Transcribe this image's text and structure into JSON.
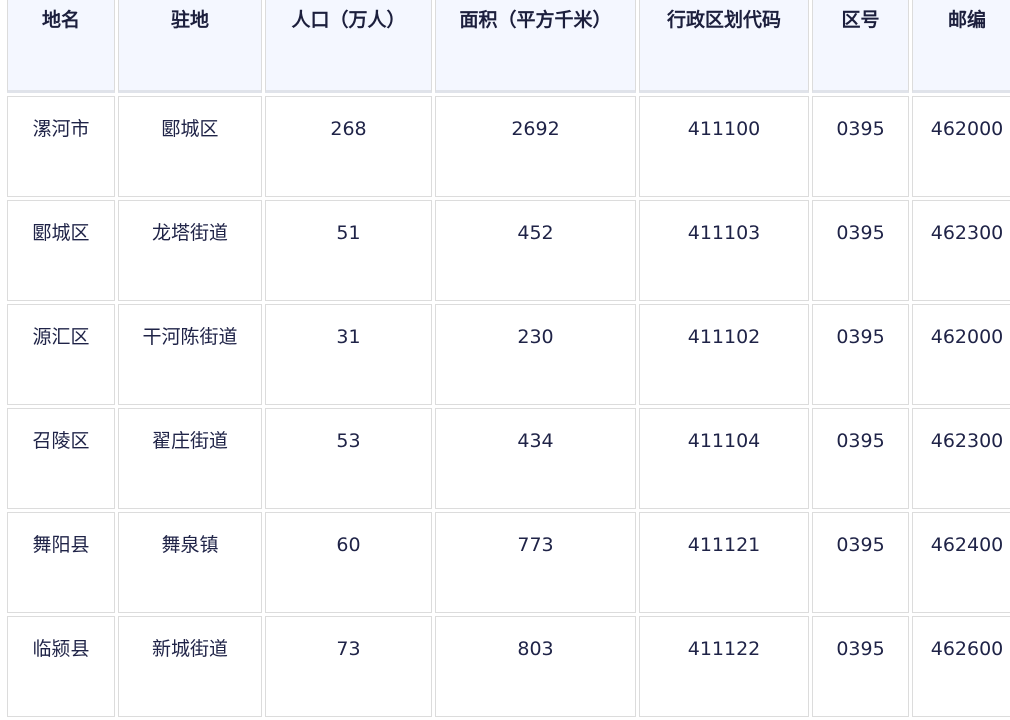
{
  "table": {
    "headers": [
      "地名",
      "驻地",
      "人口（万人）",
      "面积（平方千米）",
      "行政区划代码",
      "区号",
      "邮编"
    ],
    "rows": [
      [
        "漯河市",
        "郾城区",
        "268",
        "2692",
        "411100",
        "0395",
        "462000"
      ],
      [
        "郾城区",
        "龙塔街道",
        "51",
        "452",
        "411103",
        "0395",
        "462300"
      ],
      [
        "源汇区",
        "干河陈街道",
        "31",
        "230",
        "411102",
        "0395",
        "462000"
      ],
      [
        "召陵区",
        "翟庄街道",
        "53",
        "434",
        "411104",
        "0395",
        "462300"
      ],
      [
        "舞阳县",
        "舞泉镇",
        "60",
        "773",
        "411121",
        "0395",
        "462400"
      ],
      [
        "临颍县",
        "新城街道",
        "73",
        "803",
        "411122",
        "0395",
        "462600"
      ]
    ]
  }
}
